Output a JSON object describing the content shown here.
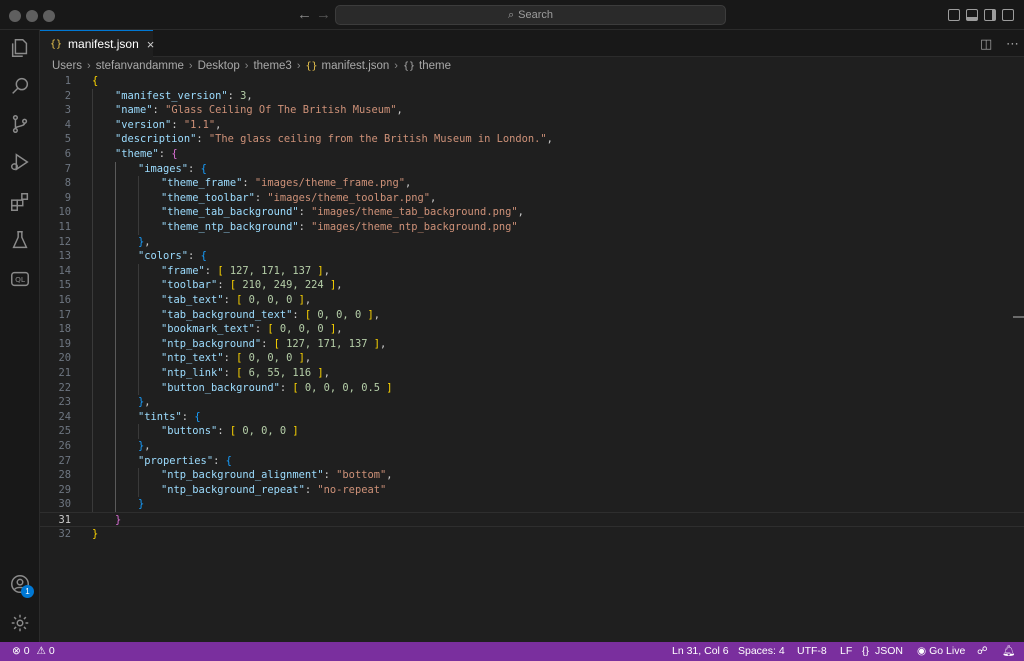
{
  "titlebar": {
    "search_placeholder": "Search",
    "search_icon": "search-icon"
  },
  "tab": {
    "icon_glyph": "{}",
    "label": "manifest.json",
    "close_glyph": "×"
  },
  "breadcrumb": {
    "items": [
      "Users",
      "stefanvandamme",
      "Desktop",
      "theme3"
    ],
    "file_icon_glyph": "{}",
    "file": "manifest.json",
    "symbol_icon_glyph": "{}",
    "symbol": "theme"
  },
  "editor": {
    "current_line": 31,
    "lines": [
      {
        "no": "1",
        "indent": 0,
        "tokens": [
          {
            "t": "{",
            "c": "b1"
          }
        ]
      },
      {
        "no": "2",
        "indent": 1,
        "tokens": [
          {
            "t": "\"manifest_version\"",
            "c": "k"
          },
          {
            "t": ": ",
            "c": "p"
          },
          {
            "t": "3",
            "c": "n"
          },
          {
            "t": ",",
            "c": "p"
          }
        ]
      },
      {
        "no": "3",
        "indent": 1,
        "tokens": [
          {
            "t": "\"name\"",
            "c": "k"
          },
          {
            "t": ": ",
            "c": "p"
          },
          {
            "t": "\"Glass Ceiling Of The British Museum\"",
            "c": "s"
          },
          {
            "t": ",",
            "c": "p"
          }
        ]
      },
      {
        "no": "4",
        "indent": 1,
        "tokens": [
          {
            "t": "\"version\"",
            "c": "k"
          },
          {
            "t": ": ",
            "c": "p"
          },
          {
            "t": "\"1.1\"",
            "c": "s"
          },
          {
            "t": ",",
            "c": "p"
          }
        ]
      },
      {
        "no": "5",
        "indent": 1,
        "tokens": [
          {
            "t": "\"description\"",
            "c": "k"
          },
          {
            "t": ": ",
            "c": "p"
          },
          {
            "t": "\"The glass ceiling from the British Museum in London.\"",
            "c": "s"
          },
          {
            "t": ",",
            "c": "p"
          }
        ]
      },
      {
        "no": "6",
        "indent": 1,
        "tokens": [
          {
            "t": "\"theme\"",
            "c": "k"
          },
          {
            "t": ": ",
            "c": "p"
          },
          {
            "t": "{",
            "c": "b2"
          }
        ]
      },
      {
        "no": "7",
        "indent": 2,
        "tokens": [
          {
            "t": "\"images\"",
            "c": "k"
          },
          {
            "t": ": ",
            "c": "p"
          },
          {
            "t": "{",
            "c": "b3"
          }
        ]
      },
      {
        "no": "8",
        "indent": 3,
        "tokens": [
          {
            "t": "\"theme_frame\"",
            "c": "k"
          },
          {
            "t": ": ",
            "c": "p"
          },
          {
            "t": "\"images/theme_frame.png\"",
            "c": "s"
          },
          {
            "t": ",",
            "c": "p"
          }
        ]
      },
      {
        "no": "9",
        "indent": 3,
        "tokens": [
          {
            "t": "\"theme_toolbar\"",
            "c": "k"
          },
          {
            "t": ": ",
            "c": "p"
          },
          {
            "t": "\"images/theme_toolbar.png\"",
            "c": "s"
          },
          {
            "t": ",",
            "c": "p"
          }
        ]
      },
      {
        "no": "10",
        "indent": 3,
        "tokens": [
          {
            "t": "\"theme_tab_background\"",
            "c": "k"
          },
          {
            "t": ": ",
            "c": "p"
          },
          {
            "t": "\"images/theme_tab_background.png\"",
            "c": "s"
          },
          {
            "t": ",",
            "c": "p"
          }
        ]
      },
      {
        "no": "11",
        "indent": 3,
        "tokens": [
          {
            "t": "\"theme_ntp_background\"",
            "c": "k"
          },
          {
            "t": ": ",
            "c": "p"
          },
          {
            "t": "\"images/theme_ntp_background.png\"",
            "c": "s"
          }
        ]
      },
      {
        "no": "12",
        "indent": 2,
        "tokens": [
          {
            "t": "}",
            "c": "b3"
          },
          {
            "t": ",",
            "c": "p"
          }
        ]
      },
      {
        "no": "13",
        "indent": 2,
        "tokens": [
          {
            "t": "\"colors\"",
            "c": "k"
          },
          {
            "t": ": ",
            "c": "p"
          },
          {
            "t": "{",
            "c": "b3"
          }
        ]
      },
      {
        "no": "14",
        "indent": 3,
        "tokens": [
          {
            "t": "\"frame\"",
            "c": "k"
          },
          {
            "t": ": ",
            "c": "p"
          },
          {
            "t": "[",
            "c": "b1"
          },
          {
            "t": " 127, 171, 137 ",
            "c": "n"
          },
          {
            "t": "]",
            "c": "b1"
          },
          {
            "t": ",",
            "c": "p"
          }
        ]
      },
      {
        "no": "15",
        "indent": 3,
        "tokens": [
          {
            "t": "\"toolbar\"",
            "c": "k"
          },
          {
            "t": ": ",
            "c": "p"
          },
          {
            "t": "[",
            "c": "b1"
          },
          {
            "t": " 210, 249, 224 ",
            "c": "n"
          },
          {
            "t": "]",
            "c": "b1"
          },
          {
            "t": ",",
            "c": "p"
          }
        ]
      },
      {
        "no": "16",
        "indent": 3,
        "tokens": [
          {
            "t": "\"tab_text\"",
            "c": "k"
          },
          {
            "t": ": ",
            "c": "p"
          },
          {
            "t": "[",
            "c": "b1"
          },
          {
            "t": " 0, 0, 0 ",
            "c": "n"
          },
          {
            "t": "]",
            "c": "b1"
          },
          {
            "t": ",",
            "c": "p"
          }
        ]
      },
      {
        "no": "17",
        "indent": 3,
        "tokens": [
          {
            "t": "\"tab_background_text\"",
            "c": "k"
          },
          {
            "t": ": ",
            "c": "p"
          },
          {
            "t": "[",
            "c": "b1"
          },
          {
            "t": " 0, 0, 0 ",
            "c": "n"
          },
          {
            "t": "]",
            "c": "b1"
          },
          {
            "t": ",",
            "c": "p"
          }
        ]
      },
      {
        "no": "18",
        "indent": 3,
        "tokens": [
          {
            "t": "\"bookmark_text\"",
            "c": "k"
          },
          {
            "t": ": ",
            "c": "p"
          },
          {
            "t": "[",
            "c": "b1"
          },
          {
            "t": " 0, 0, 0 ",
            "c": "n"
          },
          {
            "t": "]",
            "c": "b1"
          },
          {
            "t": ",",
            "c": "p"
          }
        ]
      },
      {
        "no": "19",
        "indent": 3,
        "tokens": [
          {
            "t": "\"ntp_background\"",
            "c": "k"
          },
          {
            "t": ": ",
            "c": "p"
          },
          {
            "t": "[",
            "c": "b1"
          },
          {
            "t": " 127, 171, 137 ",
            "c": "n"
          },
          {
            "t": "]",
            "c": "b1"
          },
          {
            "t": ",",
            "c": "p"
          }
        ]
      },
      {
        "no": "20",
        "indent": 3,
        "tokens": [
          {
            "t": "\"ntp_text\"",
            "c": "k"
          },
          {
            "t": ": ",
            "c": "p"
          },
          {
            "t": "[",
            "c": "b1"
          },
          {
            "t": " 0, 0, 0 ",
            "c": "n"
          },
          {
            "t": "]",
            "c": "b1"
          },
          {
            "t": ",",
            "c": "p"
          }
        ]
      },
      {
        "no": "21",
        "indent": 3,
        "tokens": [
          {
            "t": "\"ntp_link\"",
            "c": "k"
          },
          {
            "t": ": ",
            "c": "p"
          },
          {
            "t": "[",
            "c": "b1"
          },
          {
            "t": " 6, 55, 116 ",
            "c": "n"
          },
          {
            "t": "]",
            "c": "b1"
          },
          {
            "t": ",",
            "c": "p"
          }
        ]
      },
      {
        "no": "22",
        "indent": 3,
        "tokens": [
          {
            "t": "\"button_background\"",
            "c": "k"
          },
          {
            "t": ": ",
            "c": "p"
          },
          {
            "t": "[",
            "c": "b1"
          },
          {
            "t": " 0, 0, 0, 0.5 ",
            "c": "n"
          },
          {
            "t": "]",
            "c": "b1"
          }
        ]
      },
      {
        "no": "23",
        "indent": 2,
        "tokens": [
          {
            "t": "}",
            "c": "b3"
          },
          {
            "t": ",",
            "c": "p"
          }
        ]
      },
      {
        "no": "24",
        "indent": 2,
        "tokens": [
          {
            "t": "\"tints\"",
            "c": "k"
          },
          {
            "t": ": ",
            "c": "p"
          },
          {
            "t": "{",
            "c": "b3"
          }
        ]
      },
      {
        "no": "25",
        "indent": 3,
        "tokens": [
          {
            "t": "\"buttons\"",
            "c": "k"
          },
          {
            "t": ": ",
            "c": "p"
          },
          {
            "t": "[",
            "c": "b1"
          },
          {
            "t": " 0, 0, 0 ",
            "c": "n"
          },
          {
            "t": "]",
            "c": "b1"
          }
        ]
      },
      {
        "no": "26",
        "indent": 2,
        "tokens": [
          {
            "t": "}",
            "c": "b3"
          },
          {
            "t": ",",
            "c": "p"
          }
        ]
      },
      {
        "no": "27",
        "indent": 2,
        "tokens": [
          {
            "t": "\"properties\"",
            "c": "k"
          },
          {
            "t": ": ",
            "c": "p"
          },
          {
            "t": "{",
            "c": "b3"
          }
        ]
      },
      {
        "no": "28",
        "indent": 3,
        "tokens": [
          {
            "t": "\"ntp_background_alignment\"",
            "c": "k"
          },
          {
            "t": ": ",
            "c": "p"
          },
          {
            "t": "\"bottom\"",
            "c": "s"
          },
          {
            "t": ",",
            "c": "p"
          }
        ]
      },
      {
        "no": "29",
        "indent": 3,
        "tokens": [
          {
            "t": "\"ntp_background_repeat\"",
            "c": "k"
          },
          {
            "t": ": ",
            "c": "p"
          },
          {
            "t": "\"no-repeat\"",
            "c": "s"
          }
        ]
      },
      {
        "no": "30",
        "indent": 2,
        "tokens": [
          {
            "t": "}",
            "c": "b3"
          }
        ]
      },
      {
        "no": "31",
        "indent": 1,
        "tokens": [
          {
            "t": "}",
            "c": "b2"
          }
        ]
      },
      {
        "no": "32",
        "indent": 0,
        "tokens": [
          {
            "t": "}",
            "c": "b1"
          }
        ]
      }
    ]
  },
  "statusbar": {
    "errors": "0",
    "warnings": "0",
    "error_icon": "error-circle-icon",
    "warning_icon": "warning-triangle-icon",
    "cursor": "Ln 31, Col 6",
    "spaces": "Spaces: 4",
    "encoding": "UTF-8",
    "eol": "LF",
    "language_icon_glyph": "{}",
    "language": "JSON",
    "go_live": "Go Live",
    "go_live_icon": "broadcast-icon",
    "feedback_icon": "feedback-icon",
    "bell_icon": "bell-icon"
  },
  "activitybar": {
    "accounts_badge": "1",
    "items": [
      "explorer-icon",
      "search-icon",
      "source-control-icon",
      "run-debug-icon",
      "extensions-icon",
      "testing-icon",
      "codeql-icon",
      "accounts-icon",
      "settings-gear-icon"
    ]
  },
  "colors": {
    "status_bar": "#7a2f9e",
    "accent": "#0078d4",
    "editor_bg": "#1f1f1f",
    "json_key": "#9cdcfe",
    "json_string": "#ce9178",
    "json_number": "#b5cea8"
  }
}
